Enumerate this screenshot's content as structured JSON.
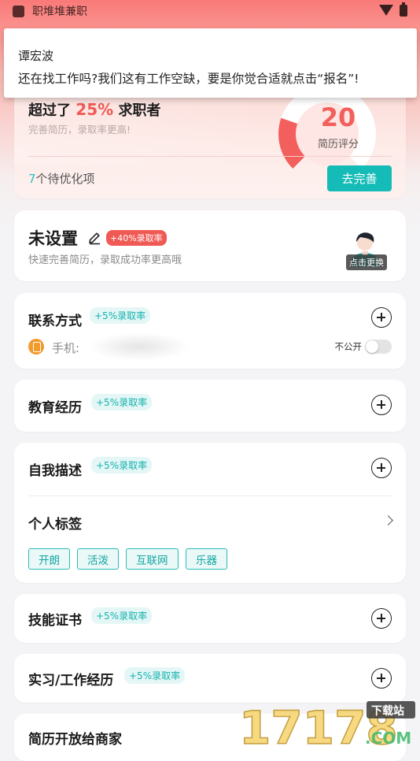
{
  "status_bar": {
    "app_name": "职堆堆兼职"
  },
  "notification": {
    "title": "谭宏波",
    "body": "还在找工作吗?我们这有工作空缺，要是你觉合适就点击“报名”!"
  },
  "score_card": {
    "beat_prefix": "超过了",
    "beat_percent": "25%",
    "beat_suffix": "求职者",
    "subtitle": "完善简历，录取率更高!",
    "score": "20",
    "score_label": "简历评分",
    "pending_count": "7",
    "pending_text": "个待优化项",
    "improve_button": "去完善"
  },
  "profile": {
    "name": "未设置",
    "badge": "+40%录取率",
    "subtitle": "快速完善简历，录取成功率更高哦",
    "avatar_tag": "点击更换"
  },
  "contact": {
    "title": "联系方式",
    "badge": "+5%录取率",
    "phone_label": "手机:",
    "private_label": "不公开",
    "private_on": false
  },
  "education": {
    "title": "教育经历",
    "badge": "+5%录取率"
  },
  "self_desc": {
    "title": "自我描述",
    "badge": "+5%录取率"
  },
  "tags": {
    "title": "个人标签",
    "items": [
      "开朗",
      "活泼",
      "互联网",
      "乐器"
    ]
  },
  "skills": {
    "title": "技能证书",
    "badge": "+5%录取率"
  },
  "experience": {
    "title": "实习/工作经历",
    "badge": "+5%录取率"
  },
  "open_section": {
    "title": "简历开放给商家"
  },
  "watermark": {
    "text": "17178",
    "tagline": "下载站",
    "domain": ".COM"
  },
  "colors": {
    "accent": "#15bcb7",
    "red": "#f25f5c",
    "orange": "#f39a2d"
  }
}
